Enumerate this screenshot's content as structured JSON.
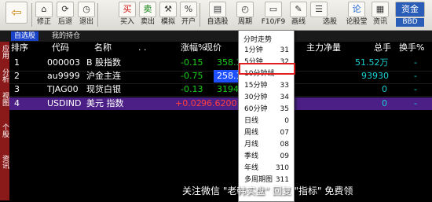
{
  "toolbar": {
    "buttons": [
      {
        "icon": "back-arrow-icon",
        "label": ""
      },
      {
        "icon": "home-icon",
        "label": "修正"
      },
      {
        "icon": "refresh-icon",
        "label": "后退"
      },
      {
        "icon": "clock-icon",
        "label": "退出"
      },
      {
        "icon": "buy-icon",
        "glyph": "买",
        "label": "买入"
      },
      {
        "icon": "sell-icon",
        "glyph": "卖",
        "label": "卖出"
      },
      {
        "icon": "hammer-icon",
        "label": "模拟"
      },
      {
        "icon": "percent-icon",
        "glyph": "%",
        "label": "开户"
      },
      {
        "icon": "portfolio-icon",
        "label": "自选股"
      },
      {
        "icon": "period-icon",
        "label": "周期"
      },
      {
        "icon": "f10-icon",
        "label": "F10/F9"
      },
      {
        "icon": "draw-icon",
        "label": "画线"
      },
      {
        "icon": "menu-icon",
        "label": ""
      },
      {
        "icon": "select-stock-icon",
        "label": "选股"
      },
      {
        "icon": "forum-icon",
        "glyph": "论",
        "label": "论股堂"
      },
      {
        "icon": "news-icon",
        "label": "资讯"
      },
      {
        "icon": "funds-icon",
        "glyph": "资金",
        "label": "BBD"
      }
    ]
  },
  "tabs": {
    "active": "自选股",
    "other": "我的持仓"
  },
  "sidebar": {
    "items": [
      "应用",
      "分析",
      "视图",
      "个股",
      "资讯"
    ]
  },
  "table": {
    "headers": {
      "seq": "排序",
      "code": "代码",
      "name": "名称",
      "dots": ". .",
      "change": "涨幅%",
      "price": "现价",
      "netflow": "主力净量",
      "total": "总手",
      "turnover": "换手%"
    },
    "rows": [
      {
        "seq": "1",
        "code": "000003",
        "name": "B 股指数",
        "change": "-0.15",
        "price": "358.10",
        "total": "51.52万",
        "turnover": "-"
      },
      {
        "seq": "2",
        "code": "au9999",
        "name": "沪金主连",
        "change": "-0.75",
        "price": "258.10",
        "total": "93930",
        "turnover": "-"
      },
      {
        "seq": "3",
        "code": "TJAG00",
        "name": "现货白银",
        "change": "-0.13",
        "price": "3194",
        "total": "0",
        "turnover": "-"
      },
      {
        "seq": "4",
        "code": "USDIND",
        "name": "美元 指数",
        "change": "+0.02",
        "price": "96.6200",
        "total": "0",
        "turnover": "-"
      }
    ]
  },
  "period_menu": {
    "title": "分时走势",
    "items": [
      {
        "label": "1分钟",
        "key": "31"
      },
      {
        "label": "5分钟",
        "key": "32"
      },
      {
        "label": "10分钟线",
        "key": ""
      },
      {
        "label": "15分钟",
        "key": "33"
      },
      {
        "label": "30分钟",
        "key": "34"
      },
      {
        "label": "60分钟",
        "key": "35"
      },
      {
        "label": "日线",
        "key": "0"
      },
      {
        "label": "周线",
        "key": "07"
      },
      {
        "label": "月线",
        "key": "08"
      },
      {
        "label": "季线",
        "key": "09"
      },
      {
        "label": "年线",
        "key": "310"
      },
      {
        "label": "多周期图",
        "key": "311"
      }
    ],
    "highlighted": "10分钟线"
  },
  "watermark": "关注微信 \"老韩实盘\" 回复 \"指标\" 免费领",
  "colors": {
    "down": "#19d219",
    "up": "#ff4040",
    "price": "#19d219",
    "code": "#ffffff",
    "total": "#19d2d2",
    "highlight_row": "#4b1f86",
    "menu_box": "#e02020"
  }
}
